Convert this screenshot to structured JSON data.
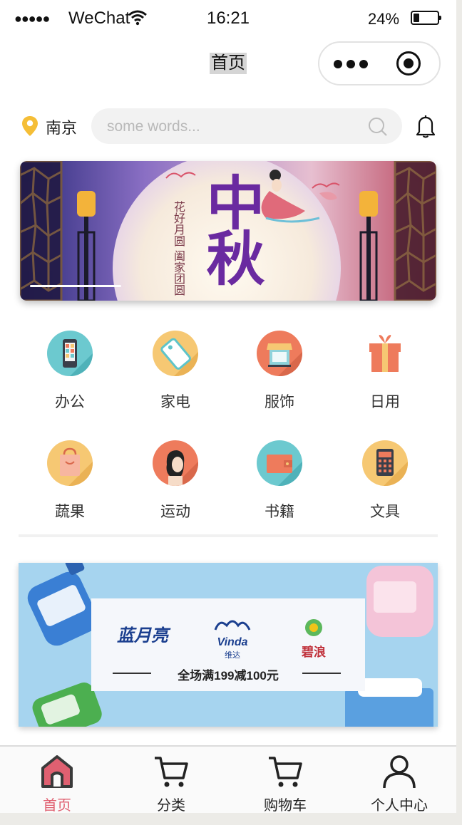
{
  "status_bar": {
    "signal": "●●●●●",
    "carrier": "WeChat",
    "time": "16:21",
    "battery": "24%"
  },
  "nav": {
    "title": "首页"
  },
  "location": {
    "city": "南京"
  },
  "search": {
    "placeholder": "some words..."
  },
  "banner": {
    "title": "中秋",
    "poem_left": "阖家团圆",
    "poem_right": "花好月圆"
  },
  "categories": [
    {
      "label": "办公",
      "icon": "phone-icon",
      "color": "#6cc9cf"
    },
    {
      "label": "家电",
      "icon": "tag-icon",
      "color": "#f6c873"
    },
    {
      "label": "服饰",
      "icon": "shop-icon",
      "color": "#ee7b5c"
    },
    {
      "label": "日用",
      "icon": "gift-icon",
      "color": "#ee7b5c"
    },
    {
      "label": "蔬果",
      "icon": "bag-icon",
      "color": "#f6c873"
    },
    {
      "label": "运动",
      "icon": "person-icon",
      "color": "#ee7b5c"
    },
    {
      "label": "书籍",
      "icon": "wallet-icon",
      "color": "#6cc9cf"
    },
    {
      "label": "文具",
      "icon": "calculator-icon",
      "color": "#f6c873"
    }
  ],
  "promo": {
    "brands": [
      "蓝月亮",
      "Vinda",
      "维达",
      "碧浪"
    ],
    "slogan": "全场满199减100元"
  },
  "tabbar": {
    "items": [
      {
        "label": "首页",
        "icon": "home-icon",
        "active": true
      },
      {
        "label": "分类",
        "icon": "cart-icon",
        "active": false
      },
      {
        "label": "购物车",
        "icon": "cart-icon",
        "active": false
      },
      {
        "label": "个人中心",
        "icon": "user-icon",
        "active": false
      }
    ],
    "active_color": "#e06071"
  }
}
